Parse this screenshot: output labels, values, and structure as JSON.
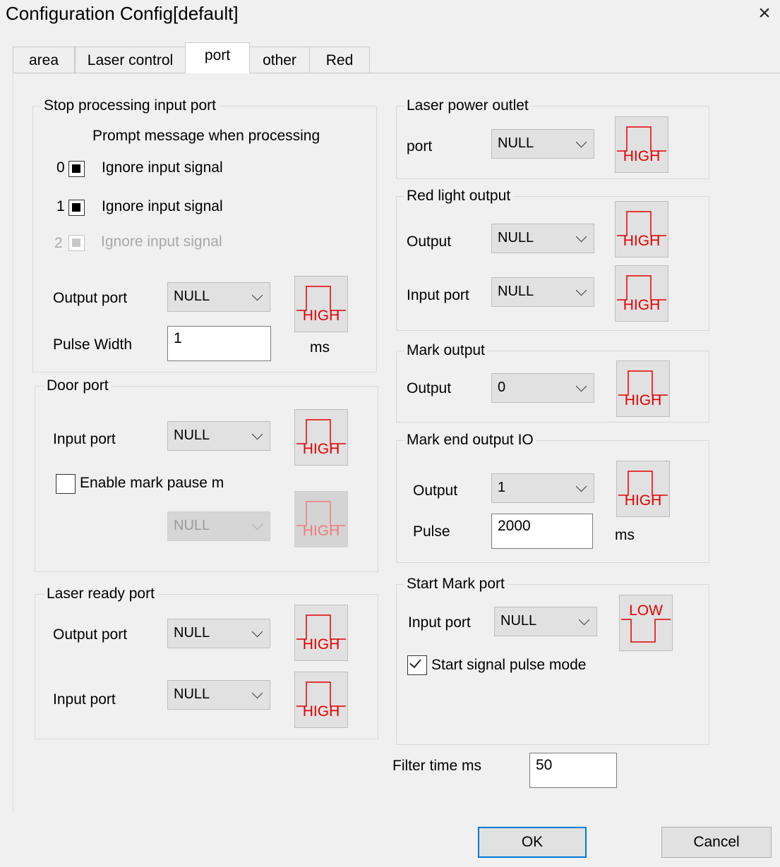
{
  "window": {
    "title": "Configuration Config[default]",
    "close_glyph": "×"
  },
  "tabs": [
    {
      "label": "area"
    },
    {
      "label": "Laser control"
    },
    {
      "label": "port",
      "active": true
    },
    {
      "label": "other"
    },
    {
      "label": "Red"
    }
  ],
  "stop_group": {
    "legend": "Stop processing input port",
    "prompt": "Prompt message when processing",
    "signals": [
      {
        "index": "0",
        "label": "Ignore input signal",
        "checked": true,
        "enabled": true
      },
      {
        "index": "1",
        "label": "Ignore input signal",
        "checked": true,
        "enabled": true
      },
      {
        "index": "2",
        "label": "Ignore input signal",
        "checked": true,
        "enabled": false
      }
    ],
    "output_port_label": "Output port",
    "output_port_value": "NULL",
    "output_level": "HIGH",
    "pulse_width_label": "Pulse Width",
    "pulse_width_value": "1",
    "pulse_unit": "ms"
  },
  "door_group": {
    "legend": "Door port",
    "input_port_label": "Input port",
    "input_port_value": "NULL",
    "input_level": "HIGH",
    "enable_pause_label": "Enable mark pause m",
    "enable_pause_checked": false,
    "pause_value": "NULL",
    "pause_level": "HIGH"
  },
  "laser_ready_group": {
    "legend": "Laser ready port",
    "output_port_label": "Output port",
    "output_port_value": "NULL",
    "output_level": "HIGH",
    "input_port_label": "Input port",
    "input_port_value": "NULL",
    "input_level": "HIGH"
  },
  "laser_power_group": {
    "legend": "Laser power outlet",
    "port_label": "port",
    "port_value": "NULL",
    "level": "HIGH"
  },
  "red_light_group": {
    "legend": "Red light output",
    "output_label": "Output",
    "output_value": "NULL",
    "output_level": "HIGH",
    "input_port_label": "Input port",
    "input_port_value": "NULL",
    "input_level": "HIGH"
  },
  "mark_output_group": {
    "legend": "Mark output",
    "output_label": "Output",
    "output_value": "0",
    "level": "HIGH"
  },
  "mark_end_group": {
    "legend": "Mark end output IO",
    "output_label": "Output",
    "output_value": "1",
    "level": "HIGH",
    "pulse_label": "Pulse",
    "pulse_value": "2000",
    "pulse_unit": "ms"
  },
  "start_mark_group": {
    "legend": "Start Mark port",
    "input_port_label": "Input port",
    "input_port_value": "NULL",
    "level": "LOW",
    "pulse_mode_label": "Start signal pulse mode",
    "pulse_mode_checked": true
  },
  "filter": {
    "label": "Filter time ms",
    "value": "50"
  },
  "buttons": {
    "ok": "OK",
    "cancel": "Cancel"
  },
  "colors": {
    "level_text": "#e10000",
    "accent": "#0078d7"
  }
}
